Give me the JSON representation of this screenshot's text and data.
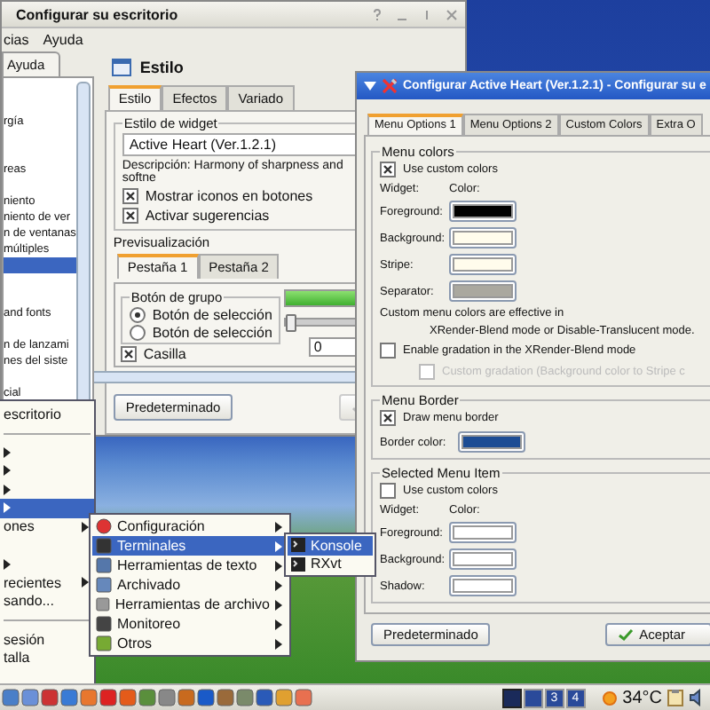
{
  "back_window": {
    "title": "Configurar su escritorio",
    "menu_bar": [
      "cias",
      "Ayuda"
    ],
    "sidebar": {
      "tab": "Ayuda",
      "items": [
        {
          "selected": false
        },
        {
          "selected": false
        },
        {
          "label": "rgía",
          "selected": false
        },
        {
          "selected": false
        },
        {
          "selected": false
        },
        {
          "label": "reas",
          "selected": false
        },
        {
          "selected": false
        },
        {
          "label": "niento",
          "selected": false
        },
        {
          "label": "niento de ver",
          "selected": false
        },
        {
          "label": "n de ventanas",
          "selected": false
        },
        {
          "label": "múltiples",
          "selected": false
        },
        {
          "selected": true
        },
        {
          "selected": false
        },
        {
          "selected": false
        },
        {
          "label": "and fonts",
          "selected": false
        },
        {
          "selected": false
        },
        {
          "label": "n de lanzami",
          "selected": false
        },
        {
          "label": "nes del siste",
          "selected": false
        },
        {
          "selected": false
        },
        {
          "label": "cial",
          "selected": false
        }
      ]
    },
    "header": "Estilo",
    "tabs": [
      {
        "label": "Estilo",
        "selected": true
      },
      {
        "label": "Efectos",
        "selected": false
      },
      {
        "label": "Variado",
        "selected": false
      }
    ],
    "widget_style": {
      "legend": "Estilo de widget",
      "value": "Active Heart (Ver.1.2.1)",
      "description": "Descripción: Harmony of sharpness and softne",
      "options": [
        {
          "label": "Mostrar iconos en botones",
          "checked": true
        },
        {
          "label": "Activar sugerencias",
          "checked": true
        }
      ]
    },
    "preview": {
      "legend": "Previsualización",
      "tabs": [
        {
          "label": "Pestaña 1",
          "selected": true
        },
        {
          "label": "Pestaña 2",
          "selected": false
        }
      ],
      "group_legend": "Botón de grupo",
      "radios": [
        {
          "label": "Botón de selección",
          "selected": true
        },
        {
          "label": "Botón de selección",
          "selected": false
        }
      ],
      "checkbox": {
        "label": "Casilla",
        "checked": true
      },
      "progress": {
        "level": 1
      },
      "slider": {
        "level": 0
      },
      "spin_value": "0"
    },
    "button": "Predeterminado"
  },
  "dialog": {
    "title": "Configurar Active Heart (Ver.1.2.1) - Configurar su e",
    "tabs": [
      {
        "label": "Menu Options 1",
        "selected": true
      },
      {
        "label": "Menu Options 2",
        "selected": false
      },
      {
        "label": "Custom Colors",
        "selected": false
      },
      {
        "label": "Extra O",
        "selected": false
      }
    ],
    "menu_colors": {
      "legend": "Menu colors",
      "use_custom": {
        "label": "Use custom colors",
        "checked": true
      },
      "widget_header": "Widget:",
      "color_header": "Color:",
      "swatches": [
        {
          "label": "Foreground:",
          "color": "#000000"
        },
        {
          "label": "Background:",
          "color": "#fffcec"
        },
        {
          "label": "Stripe:",
          "color": "#fffcec"
        },
        {
          "label": "Separator:",
          "color": "#aaa89f"
        }
      ],
      "note": [
        "Custom menu colors are effective in",
        "XRender-Blend mode or Disable-Translucent mode."
      ],
      "gradation": {
        "label": "Enable gradation in the XRender-Blend mode",
        "checked": false
      },
      "custom_gradation": {
        "label": "Custom gradation (Background color to Stripe c",
        "checked": false,
        "disabled": true
      }
    },
    "menu_border": {
      "legend": "Menu Border",
      "draw": {
        "label": "Draw menu border",
        "checked": true
      },
      "color_label": "Border color:",
      "color": "#1c4c94"
    },
    "selected_item": {
      "legend": "Selected Menu Item",
      "use_custom": {
        "label": "Use custom colors",
        "checked": false
      },
      "widget_header": "Widget:",
      "color_header": "Color:",
      "swatches": [
        {
          "label": "Foreground:",
          "color": "#ffffff"
        },
        {
          "label": "Background:",
          "color": "#ffffff"
        },
        {
          "label": "Shadow:",
          "color": "#ffffff"
        }
      ]
    },
    "buttons": [
      {
        "label": "Predeterminado",
        "kind": "plain"
      },
      {
        "label": "Aceptar",
        "kind": "ok"
      }
    ]
  },
  "k_menu": {
    "items": [
      {
        "label": "escritorio",
        "kind": "item",
        "selected": false
      },
      {
        "kind": "separator"
      },
      {
        "kind": "submenu",
        "selected": false
      },
      {
        "kind": "submenu",
        "selected": false
      },
      {
        "kind": "submenu",
        "selected": false
      },
      {
        "kind": "submenu",
        "selected": true
      },
      {
        "label": "ones",
        "kind": "submenu",
        "selected": false
      },
      {
        "kind": "item",
        "selected": false
      },
      {
        "kind": "submenu",
        "selected": false
      },
      {
        "label": "recientes",
        "kind": "submenu",
        "selected": false
      },
      {
        "label": "sando...",
        "kind": "item",
        "selected": false
      },
      {
        "kind": "separator"
      },
      {
        "label": "sesión",
        "kind": "item",
        "selected": false
      },
      {
        "label": "talla",
        "kind": "item",
        "selected": false
      }
    ]
  },
  "apps_submenu": [
    {
      "label": "Configuración",
      "selected": false
    },
    {
      "label": "Terminales",
      "selected": true
    },
    {
      "label": "Herramientas de texto",
      "selected": false
    },
    {
      "label": "Archivado",
      "selected": false
    },
    {
      "label": "Herramientas de archivo",
      "selected": false
    },
    {
      "label": "Monitoreo",
      "selected": false
    },
    {
      "label": "Otros",
      "selected": false
    }
  ],
  "terminal_submenu": [
    {
      "label": "Konsole",
      "selected": true
    },
    {
      "label": "RXvt",
      "selected": false
    }
  ],
  "taskbar": {
    "pager": [
      {
        "selected": true
      },
      {
        "selected": false
      },
      {
        "label": "3",
        "selected": false
      },
      {
        "label": "4",
        "selected": false
      }
    ],
    "temperature": "34°C"
  }
}
